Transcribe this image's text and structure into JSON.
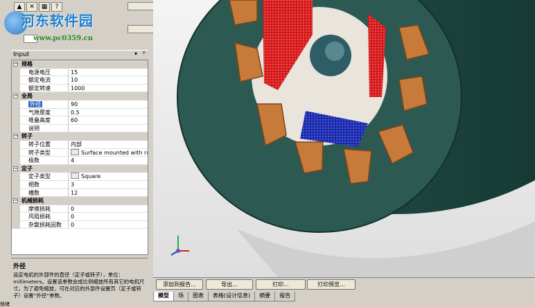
{
  "toolbar": {
    "buttons": [
      "▲",
      "✕",
      "▦",
      "?"
    ]
  },
  "watermark": {
    "brand": "河东软件园",
    "url": "www.pc0359.cn"
  },
  "panel": {
    "title": "Input",
    "drop": "▾",
    "pin": "📌"
  },
  "grid": {
    "categories": [
      {
        "label": "规格",
        "props": [
          {
            "name": "电源电压",
            "value": "15"
          },
          {
            "name": "额定电流",
            "value": "10"
          },
          {
            "name": "额定转速",
            "value": "1000"
          }
        ]
      },
      {
        "label": "全局",
        "props": [
          {
            "name": "外径",
            "value": "90",
            "selected": true
          },
          {
            "name": "气隙厚度",
            "value": "0.5"
          },
          {
            "name": "堆叠高度",
            "value": "60"
          },
          {
            "name": "说明",
            "value": ""
          }
        ]
      },
      {
        "label": "转子",
        "props": [
          {
            "name": "转子位置",
            "value": "内部"
          },
          {
            "name": "转子类型",
            "value": "Surface mounted with ra...",
            "icon": true
          },
          {
            "name": "极数",
            "value": "4"
          }
        ]
      },
      {
        "label": "定子",
        "props": [
          {
            "name": "定子类型",
            "value": "Square",
            "icon": true
          },
          {
            "name": "相数",
            "value": "3"
          },
          {
            "name": "槽数",
            "value": "12"
          }
        ]
      },
      {
        "label": "机械损耗",
        "props": [
          {
            "name": "摩擦损耗",
            "value": "0"
          },
          {
            "name": "风阻损耗",
            "value": "0"
          },
          {
            "name": "杂散损耗因数",
            "value": "0"
          }
        ]
      }
    ]
  },
  "description": {
    "heading": "外径",
    "body": "设定电机的外部件的直径（定子或转子），单位：millimeters。设置该参数会成比例缩放所有其它的电机尺寸。为了避免缩放，可在对应的外部件设置页（定子或转子）设置“外径”参数。"
  },
  "bottom": {
    "buttons": [
      "添加到报告...",
      "导出...",
      "打印...",
      "打印预览..."
    ],
    "tabs": [
      "模型",
      "场",
      "图表",
      "表格(设计信息)",
      "摘要",
      "报告"
    ],
    "active_tab": 0
  },
  "status": "就绪"
}
